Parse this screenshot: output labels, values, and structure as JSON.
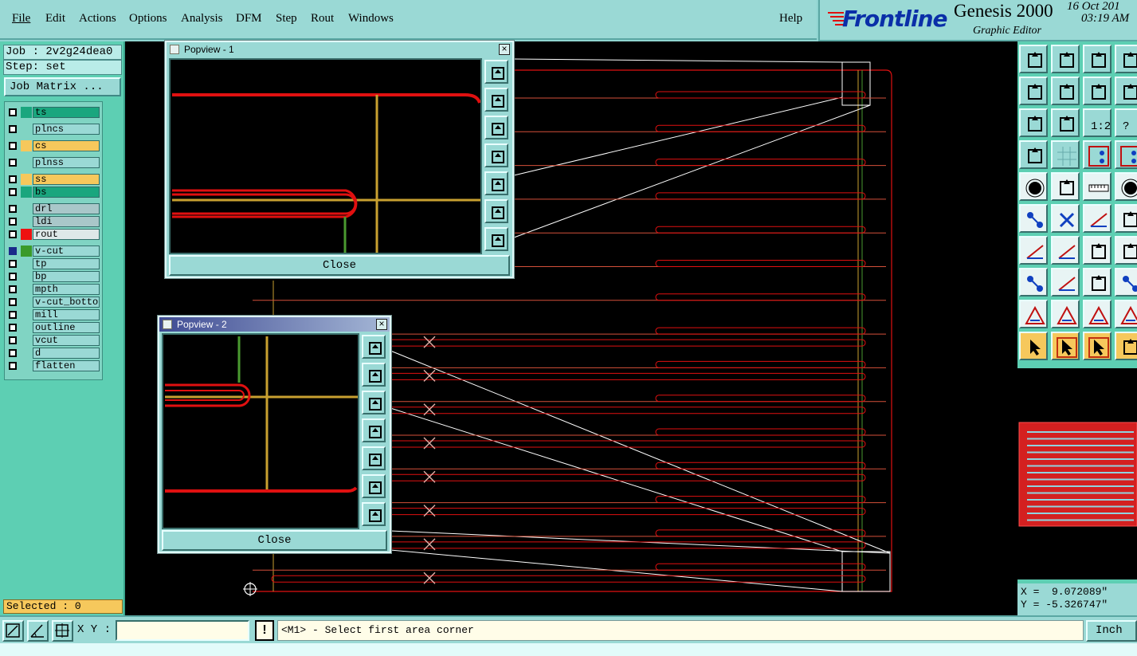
{
  "menubar": {
    "items": [
      "File",
      "Edit",
      "Actions",
      "Options",
      "Analysis",
      "DFM",
      "Step",
      "Rout",
      "Windows"
    ],
    "help": "Help"
  },
  "brand": {
    "logo": "Frontline",
    "title": "Genesis 2000",
    "subtitle": "Graphic Editor",
    "date": "16 Oct 201",
    "time": "03:19 AM"
  },
  "job": {
    "job_line": "Job : 2v2g24dea0",
    "step_line": "Step: set",
    "matrix_label": "Job Matrix ..."
  },
  "layers": [
    {
      "name": "ts",
      "swatch": "#1aa67e",
      "name_bg": "#1aa67e"
    },
    {
      "name": "plncs",
      "swatch": "",
      "name_bg": "#9ad9d5"
    },
    {
      "name": "cs",
      "swatch": "#f6c85c",
      "name_bg": "#f6c85c"
    },
    {
      "name": "plnss",
      "swatch": "",
      "name_bg": "#9ad9d5"
    },
    {
      "name": "ss",
      "swatch": "#f6c85c",
      "name_bg": "#f6c85c"
    },
    {
      "name": "bs",
      "swatch": "#1aa67e",
      "name_bg": "#1aa67e"
    },
    {
      "name": "drl",
      "swatch": "",
      "name_bg": "#a9c7c9"
    },
    {
      "name": "ldi",
      "swatch": "",
      "name_bg": "#a9c7c9"
    },
    {
      "name": "rout",
      "swatch": "#ee1111",
      "name_bg": "#dde8e8"
    },
    {
      "name": "v-cut",
      "swatch": "#3a9a2a",
      "name_bg": "#9ad9d5"
    },
    {
      "name": "tp",
      "swatch": "",
      "name_bg": "#9ad9d5"
    },
    {
      "name": "bp",
      "swatch": "",
      "name_bg": "#9ad9d5"
    },
    {
      "name": "mpth",
      "swatch": "",
      "name_bg": "#9ad9d5"
    },
    {
      "name": "v-cut_botton",
      "swatch": "",
      "name_bg": "#9ad9d5"
    },
    {
      "name": "mill",
      "swatch": "",
      "name_bg": "#9ad9d5"
    },
    {
      "name": "outline",
      "swatch": "",
      "name_bg": "#9ad9d5"
    },
    {
      "name": "vcut",
      "swatch": "",
      "name_bg": "#9ad9d5"
    },
    {
      "name": "d",
      "swatch": "",
      "name_bg": "#9ad9d5"
    },
    {
      "name": "flatten",
      "swatch": "",
      "name_bg": "#9ad9d5"
    }
  ],
  "selected": "Selected : 0",
  "popups": [
    {
      "title": "Popview - 1",
      "close_label": "Close",
      "close_x": "×"
    },
    {
      "title": "Popview - 2",
      "close_label": "Close",
      "close_x": "×"
    }
  ],
  "coords": {
    "x": "X =  9.072089\"",
    "y": "Y = -5.326747\""
  },
  "status": {
    "xy_label": "X Y :",
    "xy_value": "",
    "alert": "!",
    "message": "<M1> - Select first area corner",
    "unit": "Inch"
  },
  "tool_labels": {
    "ratio": "1:2",
    "question": "?"
  },
  "colors": {
    "panel": "#5dcfb3",
    "menu": "#9ad9d5",
    "rout_red": "#e01010",
    "trace": "#d4503a",
    "vcut_yellow": "#c8a030",
    "vcut_green": "#4a9a30",
    "highlight": "#f6c85c"
  }
}
